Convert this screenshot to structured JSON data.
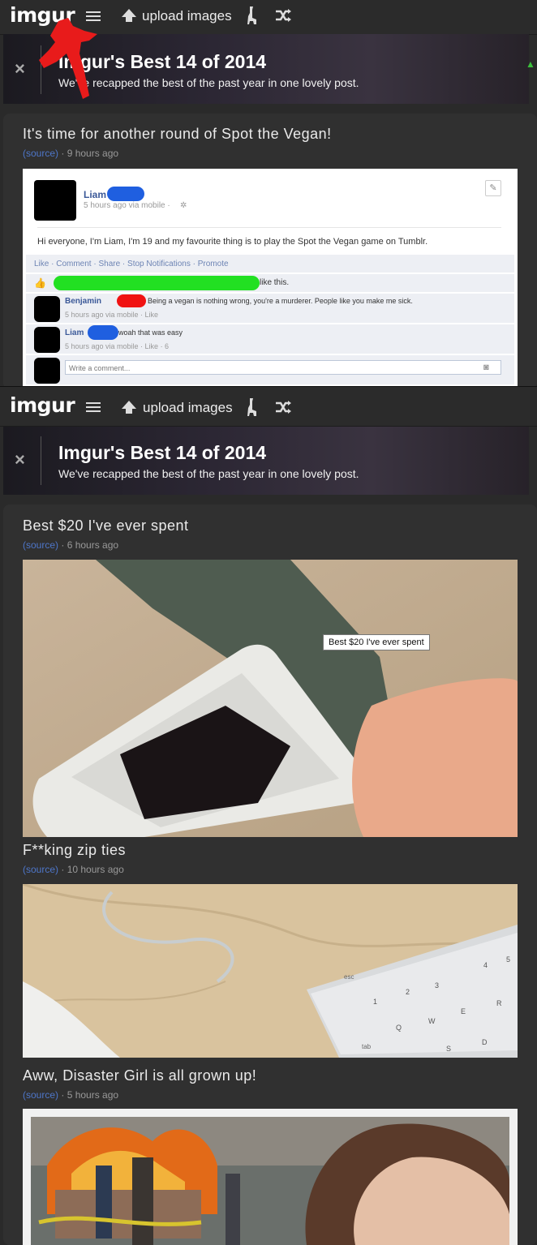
{
  "header": {
    "logo": "imgur",
    "upload_label": "upload images"
  },
  "banner": {
    "title": "Imgur's Best 14 of 2014",
    "subtitle": "We've recapped the best of the past year in one lovely post.",
    "close": "×"
  },
  "posts": [
    {
      "title": "It's time for another round of Spot the Vegan!",
      "source": "(source)",
      "time": "· 9 hours ago",
      "fb": {
        "name": "Liam",
        "subline": "5 hours ago via mobile ·",
        "status": "Hi everyone, I'm Liam, I'm 19 and my favourite thing is to play the Spot the Vegan game on Tumblr.",
        "actions": "Like · Comment · Share · Stop Notifications · Promote",
        "likes_suffix": "like this.",
        "comments": [
          {
            "name": "Benjamin",
            "text": "Being a vegan is nothing wrong, you're a murderer. People like you make me sick.",
            "meta": "5 hours ago via mobile · Like"
          },
          {
            "name": "Liam",
            "text": "woah that was easy",
            "meta": "5 hours ago via mobile · Like · 6"
          }
        ],
        "comment_placeholder": "Write a comment..."
      }
    },
    {
      "title": "Best $20 I've ever spent",
      "source": "(source)",
      "time": "· 6 hours ago",
      "tooltip": "Best $20 I've ever spent"
    },
    {
      "title": "F**king zip ties",
      "source": "(source)",
      "time": "· 10 hours ago"
    },
    {
      "title": "Aww, Disaster Girl is all grown up!",
      "source": "(source)",
      "time": "· 5 hours ago"
    }
  ],
  "keyboard_keys": [
    "esc",
    "1",
    "2",
    "3",
    "4",
    "5",
    "Q",
    "W",
    "E",
    "R",
    "S",
    "D",
    "tab"
  ],
  "colors": {
    "accent": "#4e76c9",
    "fb_blue": "#3b5998",
    "annotation_red": "#e81b1b"
  }
}
